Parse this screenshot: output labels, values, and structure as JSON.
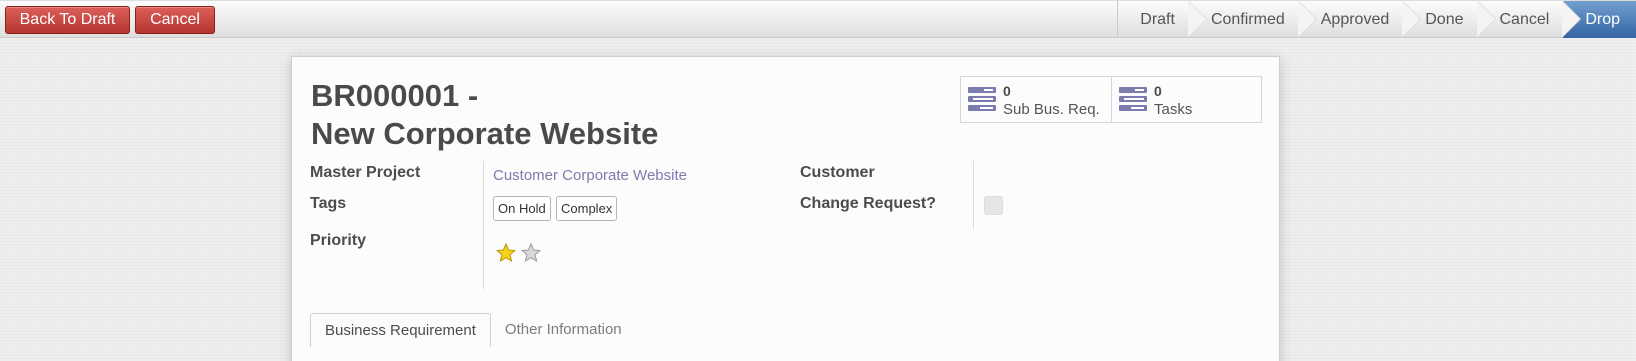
{
  "header": {
    "back_to_draft_label": "Back To Draft",
    "cancel_label": "Cancel",
    "button_color": "#c0403a",
    "active_stage_color": "#3465a4",
    "stages": [
      {
        "label": "Draft",
        "active": false
      },
      {
        "label": "Confirmed",
        "active": false
      },
      {
        "label": "Approved",
        "active": false
      },
      {
        "label": "Done",
        "active": false
      },
      {
        "label": "Cancel",
        "active": false
      },
      {
        "label": "Drop",
        "active": true
      }
    ]
  },
  "record": {
    "code": "BR000001 -",
    "name": "New Corporate Website"
  },
  "smart_buttons": [
    {
      "count": "0",
      "label": "Sub Bus. Req.",
      "icon": "tasks-icon"
    },
    {
      "count": "0",
      "label": "Tasks",
      "icon": "tasks-icon"
    }
  ],
  "fields": {
    "master_project_label": "Master Project",
    "master_project_value": "Customer Corporate Website",
    "tags_label": "Tags",
    "tags": [
      "On Hold",
      "Complex"
    ],
    "priority_label": "Priority",
    "priority_stars": 1,
    "priority_max": 2,
    "customer_label": "Customer",
    "customer_value": "",
    "change_request_label": "Change Request?",
    "change_request_checked": false
  },
  "tabs": [
    {
      "label": "Business Requirement",
      "active": true
    },
    {
      "label": "Other Information",
      "active": false
    }
  ]
}
